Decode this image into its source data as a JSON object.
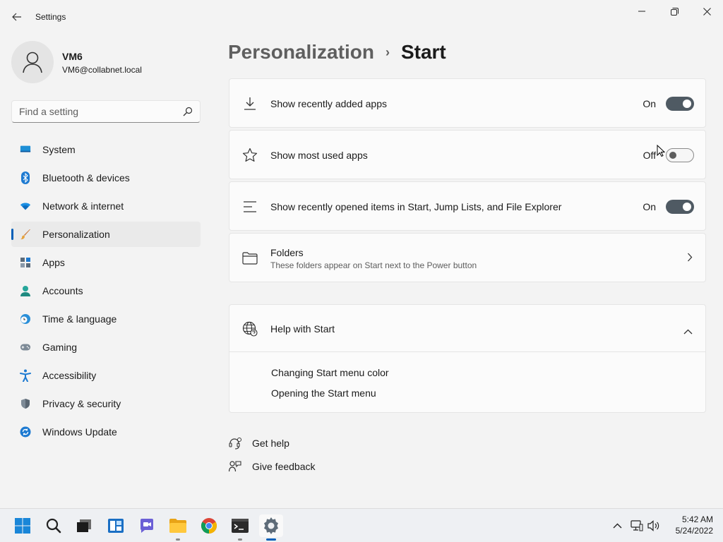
{
  "window": {
    "title": "Settings"
  },
  "profile": {
    "name": "VM6",
    "email": "VM6@collabnet.local"
  },
  "search": {
    "placeholder": "Find a setting"
  },
  "nav": {
    "items": [
      {
        "label": "System",
        "icon": "system-icon"
      },
      {
        "label": "Bluetooth & devices",
        "icon": "bluetooth-icon"
      },
      {
        "label": "Network & internet",
        "icon": "wifi-icon"
      },
      {
        "label": "Personalization",
        "icon": "brush-icon",
        "active": true
      },
      {
        "label": "Apps",
        "icon": "apps-icon"
      },
      {
        "label": "Accounts",
        "icon": "accounts-icon"
      },
      {
        "label": "Time & language",
        "icon": "clock-globe-icon"
      },
      {
        "label": "Gaming",
        "icon": "gamepad-icon"
      },
      {
        "label": "Accessibility",
        "icon": "accessibility-icon"
      },
      {
        "label": "Privacy & security",
        "icon": "shield-icon"
      },
      {
        "label": "Windows Update",
        "icon": "update-icon"
      }
    ]
  },
  "breadcrumb": {
    "parent": "Personalization",
    "separator": "›",
    "current": "Start"
  },
  "settings": {
    "recent_apps": {
      "label": "Show recently added apps",
      "state": "On",
      "on": true
    },
    "most_used": {
      "label": "Show most used apps",
      "state": "Off",
      "on": false
    },
    "recent_items": {
      "label": "Show recently opened items in Start, Jump Lists, and File Explorer",
      "state": "On",
      "on": true
    },
    "folders": {
      "label": "Folders",
      "description": "These folders appear on Start next to the Power button"
    }
  },
  "help": {
    "title": "Help with Start",
    "links": [
      "Changing Start menu color",
      "Opening the Start menu"
    ]
  },
  "footer": {
    "get_help": "Get help",
    "give_feedback": "Give feedback"
  },
  "taskbar": {
    "apps": [
      "start-icon",
      "search-icon",
      "task-view-icon",
      "widgets-icon",
      "teams-chat-icon",
      "file-explorer-icon",
      "chrome-icon",
      "terminal-icon",
      "settings-icon"
    ],
    "time": "5:42 AM",
    "date": "5/24/2022"
  },
  "colors": {
    "accent": "#005fb8",
    "toggle_on": "#4f5a63",
    "background": "#f3f3f3",
    "card": "#fbfbfb"
  }
}
